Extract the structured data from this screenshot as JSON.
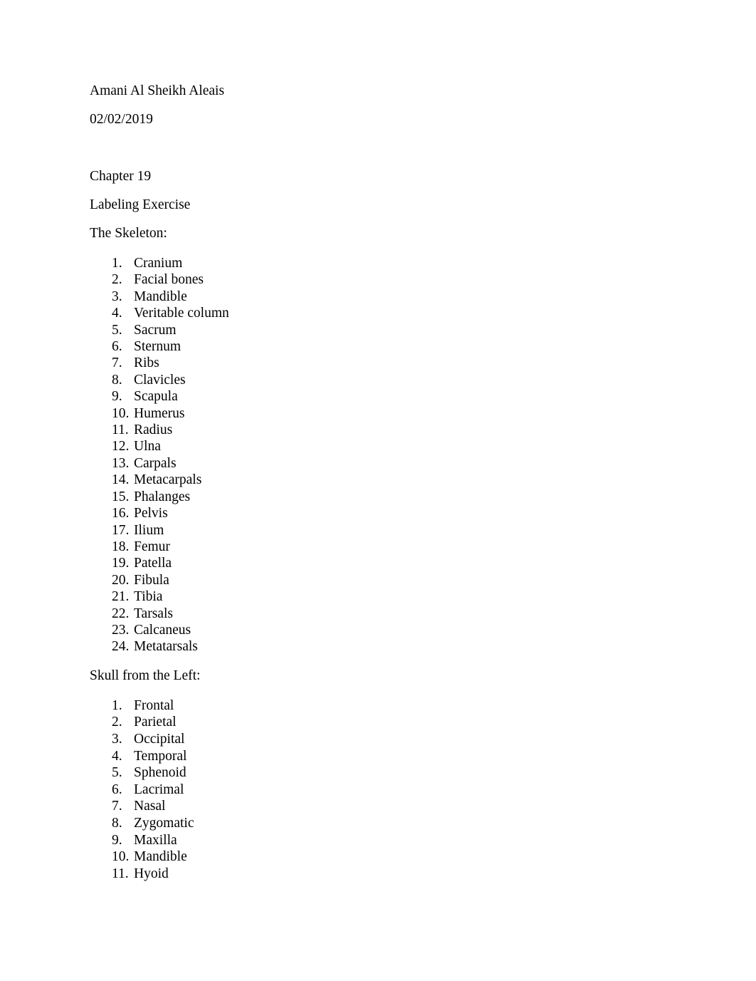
{
  "document": {
    "author": "Amani Al Sheikh Aleais",
    "date": "02/02/2019",
    "blank_line": "",
    "chapter": "Chapter 19",
    "assignment_title": "Labeling Exercise",
    "sections": [
      {
        "heading": "The Skeleton:",
        "items": [
          "Cranium",
          "Facial bones",
          "Mandible",
          "Veritable column",
          "Sacrum",
          "Sternum",
          "Ribs",
          "Clavicles",
          "Scapula",
          "Humerus",
          "Radius",
          "Ulna",
          "Carpals",
          "Metacarpals",
          "Phalanges",
          "Pelvis",
          "Ilium",
          "Femur",
          "Patella",
          "Fibula",
          "Tibia",
          "Tarsals",
          "Calcaneus",
          "Metatarsals"
        ],
        "numbers": [
          "1.",
          "2.",
          "3.",
          "4.",
          "5.",
          "6.",
          "7.",
          "8.",
          "9.",
          "10.",
          "11.",
          "12.",
          "13.",
          "14.",
          "15.",
          "16.",
          "17.",
          "18.",
          "19.",
          "20.",
          "21.",
          "22.",
          "23.",
          "24."
        ]
      },
      {
        "heading": "Skull from the Left:",
        "items": [
          "Frontal",
          "Parietal",
          "Occipital",
          "Temporal",
          "Sphenoid",
          "Lacrimal",
          "Nasal",
          "Zygomatic",
          "Maxilla",
          "Mandible",
          "Hyoid"
        ],
        "numbers": [
          "1.",
          "2.",
          "3.",
          "4.",
          "5.",
          "6.",
          "7.",
          "8.",
          "9.",
          "10.",
          "11."
        ]
      }
    ]
  },
  "colors": {
    "page_background": "#ffffff",
    "text": "#000000"
  }
}
